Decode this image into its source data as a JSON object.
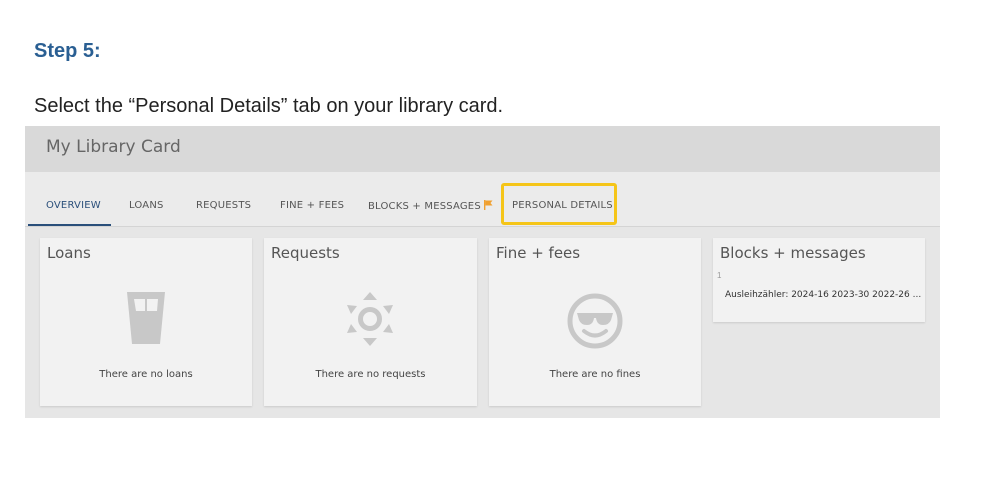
{
  "step": {
    "title": "Step 5:",
    "instruction": "Select the “Personal Details” tab on your library card."
  },
  "app": {
    "title": "My Library Card",
    "tabs": [
      {
        "label": "OVERVIEW",
        "active": true
      },
      {
        "label": "LOANS"
      },
      {
        "label": "REQUESTS"
      },
      {
        "label": "FINE + FEES"
      },
      {
        "label": "BLOCKS + MESSAGES",
        "icon": "flag-icon"
      },
      {
        "label": "PERSONAL DETAILS",
        "highlighted": true
      }
    ],
    "panels": {
      "loans": {
        "title": "Loans",
        "empty": "There are no loans",
        "icon": "glass-icon"
      },
      "requests": {
        "title": "Requests",
        "empty": "There are no requests",
        "icon": "sun-icon"
      },
      "fines": {
        "title": "Fine + fees",
        "empty": "There are no fines",
        "icon": "sunglasses-smiley-icon"
      },
      "messages": {
        "title": "Blocks + messages",
        "count": "1",
        "text": "Ausleihzähler: 2024-16 2023-30 2022-26 ..."
      }
    }
  },
  "colors": {
    "accent": "#2a4f7a",
    "highlight": "#f5c518",
    "flag": "#f0a030",
    "step_title": "#2a5f93"
  }
}
